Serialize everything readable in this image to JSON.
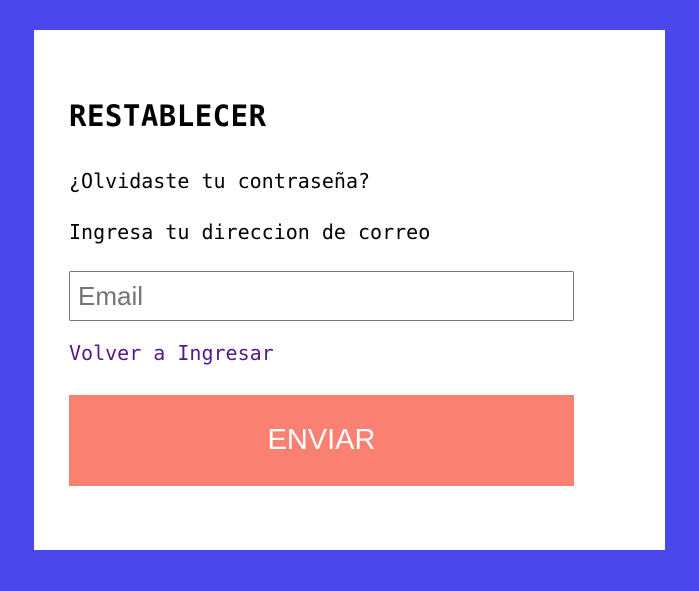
{
  "page": {
    "background_color": "#4a48ec",
    "card_color": "#ffffff"
  },
  "form": {
    "title": "RESTABLECER",
    "question": "¿Olvidaste tu contraseña?",
    "instruction": "Ingresa tu direccion de correo",
    "email_placeholder": "Email",
    "email_value": "",
    "back_link": "Volver a Ingresar",
    "submit_label": "ENVIAR",
    "submit_color": "#fa8072",
    "link_color": "#551a8b"
  }
}
